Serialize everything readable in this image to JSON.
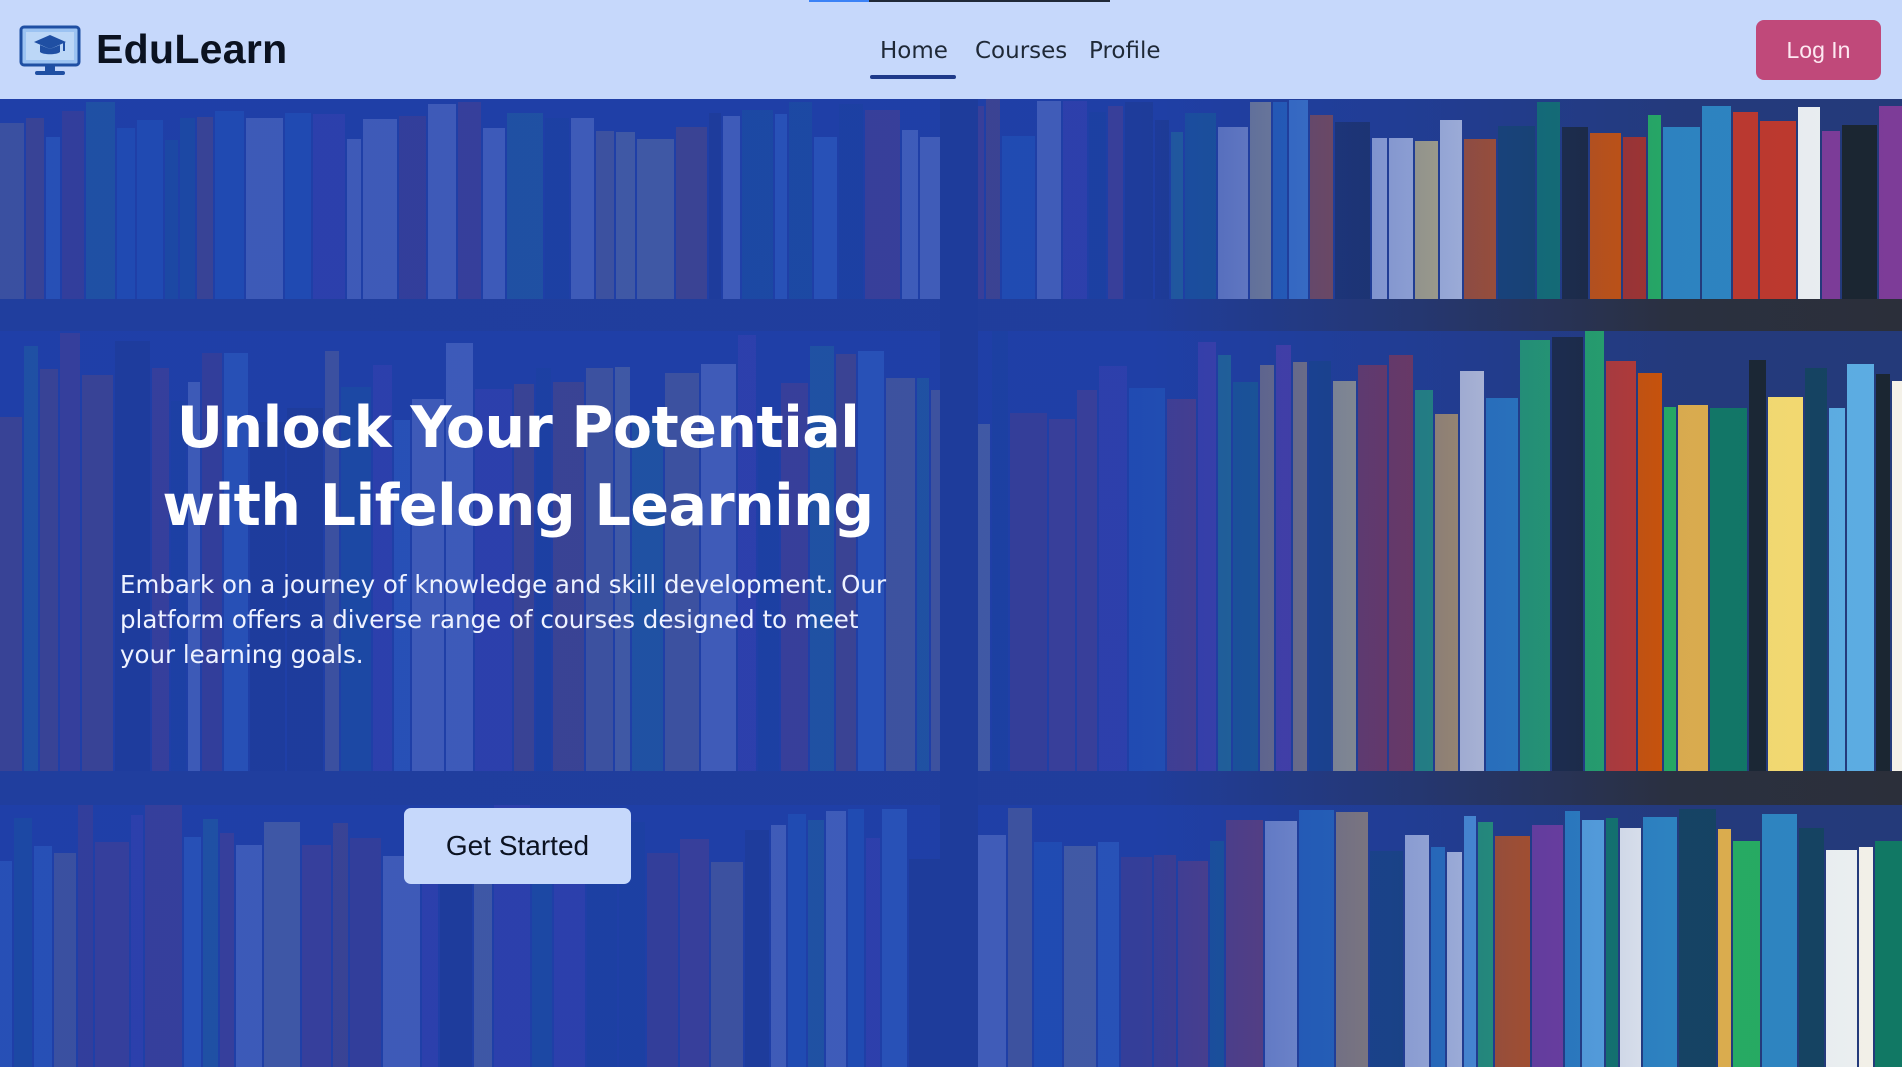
{
  "header": {
    "brand": "EduLearn",
    "logo_icon": "monitor-graduation-cap-icon",
    "nav": [
      {
        "label": "Home",
        "active": true
      },
      {
        "label": "Courses",
        "active": false
      },
      {
        "label": "Profile",
        "active": false
      }
    ],
    "login_label": "Log In"
  },
  "hero": {
    "title": "Unlock Your Potential with Lifelong Learning",
    "subtitle": "Embark on a journey of knowledge and skill development. Our platform offers a diverse range of courses designed to meet your learning goals.",
    "cta_label": "Get Started",
    "background": "bookshelf-photo"
  },
  "colors": {
    "nav_bg": "#c6d8fb",
    "hero_overlay": "#1e40af",
    "login_bg": "#c0497a",
    "cta_bg": "#c6d8fb",
    "active_underline": "#1e3a8a"
  }
}
